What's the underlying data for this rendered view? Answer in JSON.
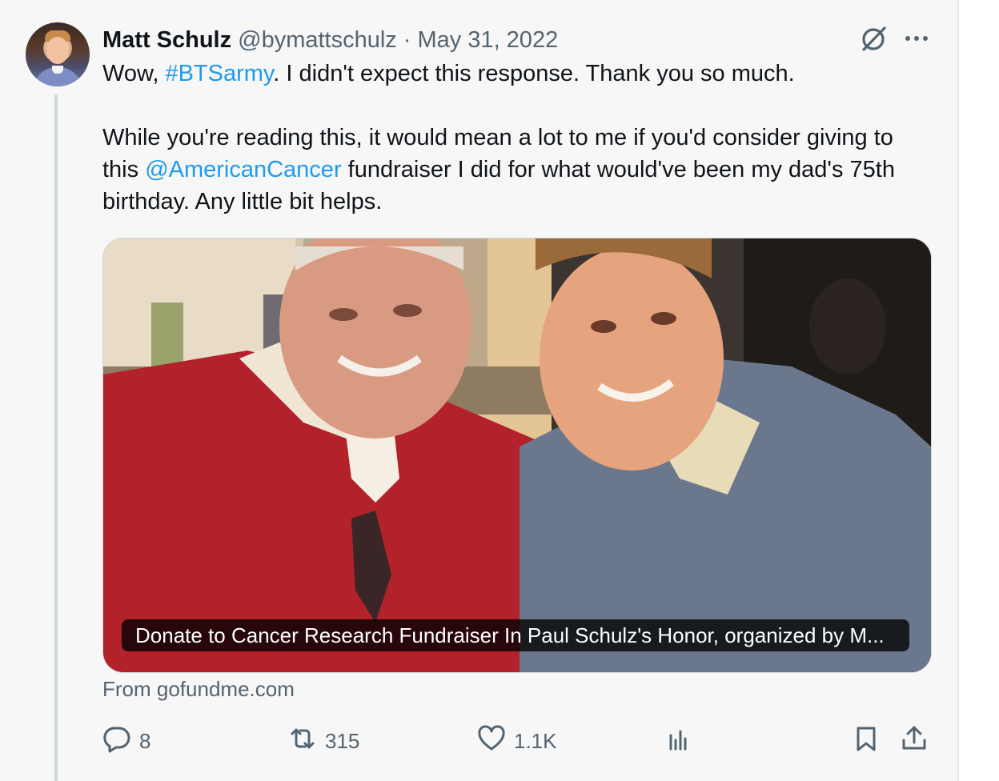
{
  "tweet": {
    "author_name": "Matt Schulz",
    "handle": "@bymattschulz",
    "separator": "·",
    "date": "May 31, 2022",
    "line1_pre": "Wow, ",
    "hashtag": "#BTSarmy",
    "line1_post": ". I didn't expect this response. Thank you so much.",
    "para2_pre": "While you're reading this, it would mean a lot to me if you'd consider giving to this ",
    "mention": "@AmericanCancer",
    "para2_post": " fundraiser I did for what would've been my dad's 75th birthday. Any little bit helps."
  },
  "card": {
    "caption": "Donate to Cancer Research Fundraiser In Paul Schulz's Honor, organized by M...",
    "source": "From gofundme.com"
  },
  "actions": {
    "replies": "8",
    "reposts": "315",
    "likes": "1.1K"
  },
  "icons": {
    "grok": "grok-icon",
    "more": "more-icon",
    "reply": "reply-icon",
    "repost": "repost-icon",
    "like": "heart-icon",
    "views": "bar-chart-icon",
    "bookmark": "bookmark-icon",
    "share": "share-icon"
  },
  "colors": {
    "link": "#1d9bf0",
    "secondary_text": "#536471",
    "primary_text": "#0f1419",
    "background": "#f7f7f7"
  }
}
